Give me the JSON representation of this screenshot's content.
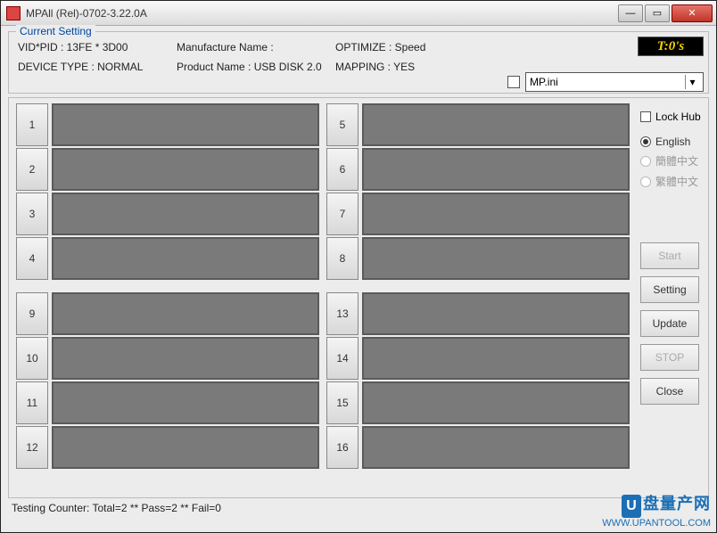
{
  "window": {
    "title": "MPAll (Rel)-0702-3.22.0A"
  },
  "timer": "T:0's",
  "settings": {
    "legend": "Current Setting",
    "vidpid": "VID*PID : 13FE * 3D00",
    "devtype": "DEVICE TYPE : NORMAL",
    "mfg": "Manufacture Name :",
    "product": "Product Name : USB DISK 2.0",
    "optimize": "OPTIMIZE : Speed",
    "mapping": "MAPPING : YES"
  },
  "ini": {
    "value": "MP.ini"
  },
  "slots": {
    "groupA_left": [
      "1",
      "2",
      "3",
      "4"
    ],
    "groupA_right": [
      "5",
      "6",
      "7",
      "8"
    ],
    "groupB_left": [
      "9",
      "10",
      "11",
      "12"
    ],
    "groupB_right": [
      "13",
      "14",
      "15",
      "16"
    ]
  },
  "sidebar": {
    "lockhub": "Lock Hub",
    "lang_en": "English",
    "lang_sc": "簡體中文",
    "lang_tc": "繁體中文",
    "start": "Start",
    "setting": "Setting",
    "update": "Update",
    "stop": "STOP",
    "close": "Close"
  },
  "status": "Testing Counter: Total=2 ** Pass=2 ** Fail=0",
  "watermark": {
    "ch": "盘量产网",
    "url": "WWW.UPANTOOL.COM"
  }
}
